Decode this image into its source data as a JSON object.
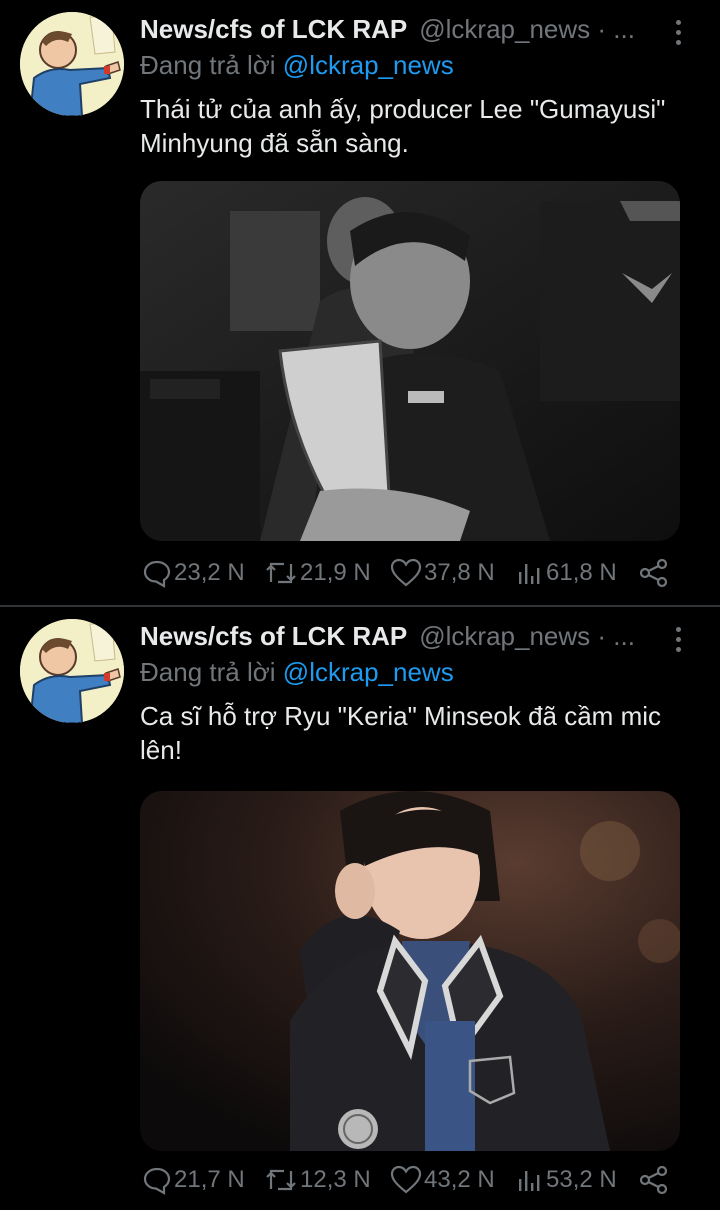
{
  "tweets": [
    {
      "author_name": "News/cfs of LCK RAP",
      "handle": "@lckrap_news · ...",
      "reply_prefix": "Đang trả lời",
      "reply_mention": "@lckrap_news",
      "text": "Thái tử của anh ấy, producer Lee \"Gumayusi\" Minhyung đã sẵn sàng.",
      "media_icon": "photo-grayscale",
      "stats": {
        "replies": "23,2 N",
        "retweets": "21,9 N",
        "likes": "37,8 N",
        "views": "61,8 N"
      }
    },
    {
      "author_name": "News/cfs of LCK RAP",
      "handle": "@lckrap_news · ...",
      "reply_prefix": "Đang trả lời",
      "reply_mention": "@lckrap_news",
      "text": "Ca sĩ hỗ trợ Ryu \"Keria\" Minseok đã cầm mic lên!",
      "media_icon": "photo-color",
      "stats": {
        "replies": "21,7 N",
        "retweets": "12,3 N",
        "likes": "43,2 N",
        "views": "53,2 N"
      }
    }
  ],
  "colors": {
    "background": "#000000",
    "text": "#e7e9ea",
    "secondary": "#71767b",
    "link": "#1d9bf0",
    "divider": "#2f3336"
  }
}
